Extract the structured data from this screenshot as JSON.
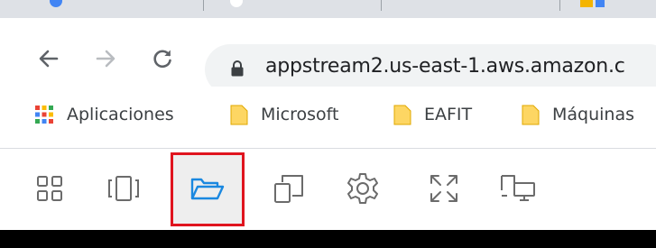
{
  "browser": {
    "tabstrip": {},
    "toolbar": {
      "back_icon": "arrow-left-icon",
      "forward_icon": "arrow-right-icon",
      "reload_icon": "reload-icon",
      "address_bar": {
        "url": "appstream2.us-east-1.aws.amazon.c",
        "secure_icon": "lock-icon"
      }
    },
    "bookmarks": [
      {
        "label": "Aplicaciones",
        "icon": "apps-grid-icon"
      },
      {
        "label": "Microsoft",
        "icon": "folder-icon"
      },
      {
        "label": "EAFIT",
        "icon": "folder-icon"
      },
      {
        "label": "Máquinas",
        "icon": "folder-icon"
      }
    ]
  },
  "appstream_toolbar": {
    "buttons": [
      {
        "icon": "catalog-grid-icon",
        "active": false
      },
      {
        "icon": "windows-switcher-icon",
        "active": false
      },
      {
        "icon": "my-files-folder-icon",
        "active": true
      },
      {
        "icon": "clipboard-copy-icon",
        "active": false
      },
      {
        "icon": "settings-gear-icon",
        "active": false
      },
      {
        "icon": "fullscreen-icon",
        "active": false
      },
      {
        "icon": "dual-monitor-icon",
        "active": false
      }
    ],
    "colors": {
      "active_outline": "#e0141e",
      "active_background": "#eeeeee",
      "active_icon": "#1a88e0",
      "icon": "#6b6b6b"
    }
  },
  "streaming_area": {
    "background": "#000000"
  }
}
